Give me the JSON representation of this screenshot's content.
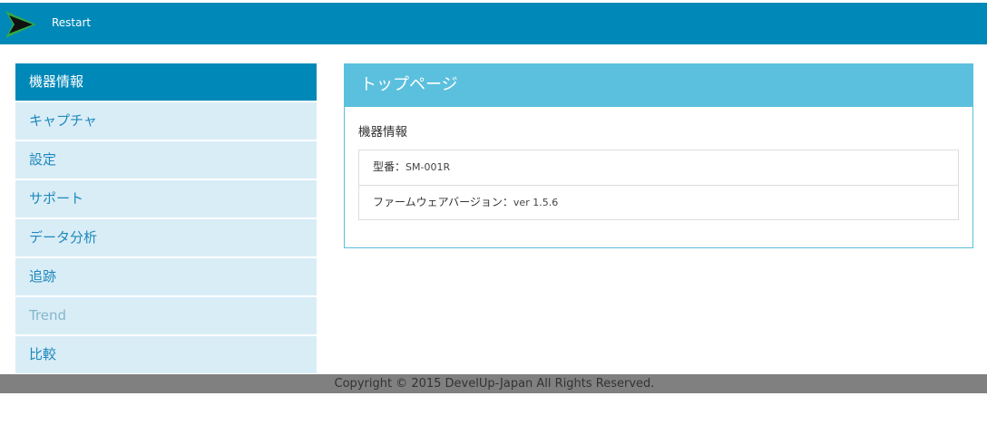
{
  "header": {
    "brand_label": "Restart",
    "logo_icon": "arrow-logo-icon",
    "colors": {
      "bar": "#0089b8"
    }
  },
  "sidebar": {
    "items": [
      {
        "label": "機器情報",
        "state": "active"
      },
      {
        "label": "キャプチャ",
        "state": "normal"
      },
      {
        "label": "設定",
        "state": "normal"
      },
      {
        "label": "サポート",
        "state": "normal"
      },
      {
        "label": "データ分析",
        "state": "normal"
      },
      {
        "label": "追跡",
        "state": "normal"
      },
      {
        "label": "Trend",
        "state": "disabled"
      },
      {
        "label": "比較",
        "state": "normal"
      }
    ]
  },
  "panel": {
    "title": "トップページ",
    "section_title": "機器情報",
    "rows": [
      {
        "label": "型番：",
        "value": "SM-001R"
      },
      {
        "label": "ファームウェアバージョン：",
        "value": "ver 1.5.6"
      }
    ]
  },
  "footer": {
    "copyright": "Copyright © 2015 DevelUp-Japan All Rights Reserved."
  }
}
